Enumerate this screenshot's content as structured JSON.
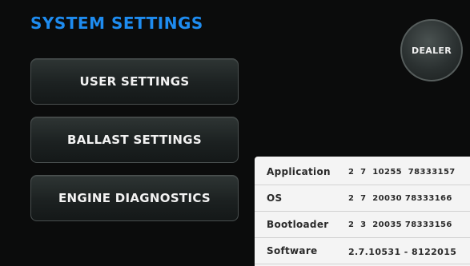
{
  "screen": {
    "title": "SYSTEM SETTINGS"
  },
  "menu": {
    "user_settings": "USER SETTINGS",
    "ballast_settings": "BALLAST SETTINGS",
    "engine_diagnostics": "ENGINE DIAGNOSTICS"
  },
  "dealer_button": "DEALER",
  "versions": [
    {
      "label": "Application",
      "value": "2  7  10255  78333157"
    },
    {
      "label": "OS",
      "value": "2  7  20030 78333166"
    },
    {
      "label": "Bootloader",
      "value": "2  3  20035 78333156"
    },
    {
      "label": "Software",
      "value": "2.7.10531 - 8122015"
    }
  ],
  "colors": {
    "title": "#1e8cf0",
    "background": "#0b0c0c",
    "panel": "#f4f4f4"
  }
}
